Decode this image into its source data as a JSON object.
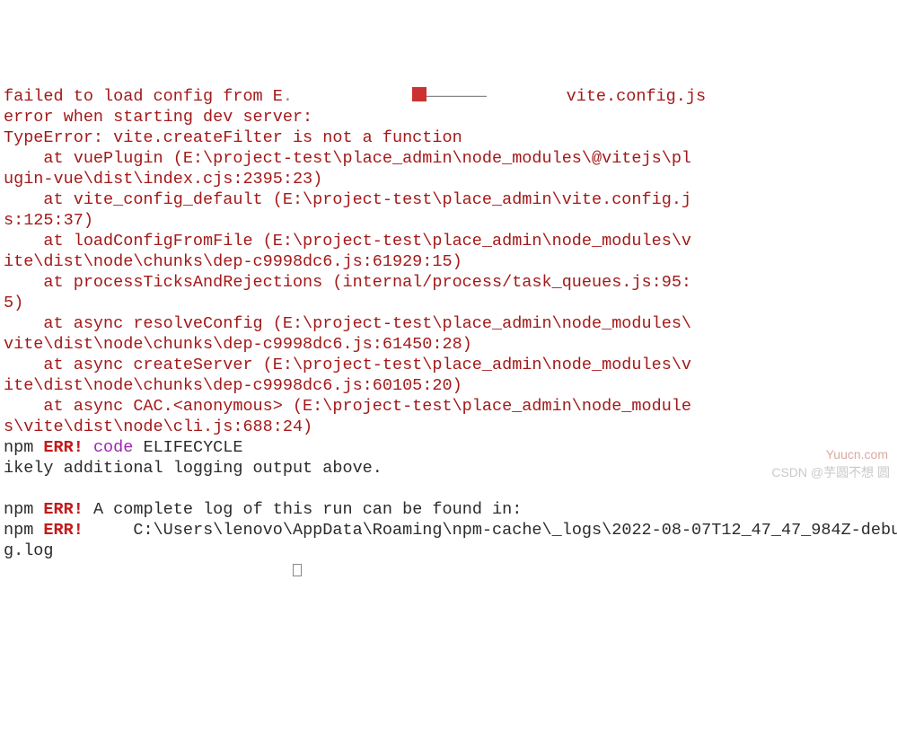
{
  "lines": [
    {
      "cls": "red",
      "pre": "failed to load config from E",
      "redblock": true,
      "mid": "",
      "after": "        vite.config.js"
    },
    {
      "cls": "red",
      "text": "error when starting dev server:"
    },
    {
      "cls": "red",
      "text": "TypeError: vite.createFilter is not a function"
    },
    {
      "cls": "red",
      "text": "    at vuePlugin (E:\\project-test\\place_admin\\node_modules\\@vitejs\\pl"
    },
    {
      "cls": "red",
      "text": "ugin-vue\\dist\\index.cjs:2395:23)"
    },
    {
      "cls": "red",
      "text": "    at vite_config_default (E:\\project-test\\place_admin\\vite.config.j"
    },
    {
      "cls": "red",
      "text": "s:125:37)"
    },
    {
      "cls": "red",
      "text": "    at loadConfigFromFile (E:\\project-test\\place_admin\\node_modules\\v"
    },
    {
      "cls": "red",
      "text": "ite\\dist\\node\\chunks\\dep-c9998dc6.js:61929:15)"
    },
    {
      "cls": "red",
      "text": "    at processTicksAndRejections (internal/process/task_queues.js:95:"
    },
    {
      "cls": "red",
      "text": "5)"
    },
    {
      "cls": "red",
      "text": "    at async resolveConfig (E:\\project-test\\place_admin\\node_modules\\"
    },
    {
      "cls": "red",
      "text": "vite\\dist\\node\\chunks\\dep-c9998dc6.js:61450:28)"
    },
    {
      "cls": "red",
      "text": "    at async createServer (E:\\project-test\\place_admin\\node_modules\\v"
    },
    {
      "cls": "red",
      "text": "ite\\dist\\node\\chunks\\dep-c9998dc6.js:60105:20)"
    },
    {
      "cls": "red",
      "text": "    at async CAC.<anonymous> (E:\\project-test\\place_admin\\node_module"
    },
    {
      "cls": "red",
      "text": "s\\vite\\dist\\node\\cli.js:688:24)"
    }
  ],
  "npm_err_code": {
    "npm": "npm",
    "err": "ERR!",
    "code": "code",
    "value": "ELIFECYCLE"
  },
  "extra_line": "ikely additional logging output above.",
  "blank": " ",
  "npm_err_log_header": {
    "npm": "npm",
    "err": "ERR!",
    "text": " A complete log of this run can be found in:"
  },
  "npm_err_log_path": {
    "npm": "npm",
    "err": "ERR!",
    "text": "     C:\\Users\\lenovo\\AppData\\Roaming\\npm-cache\\_logs\\2022-08-07T12_47_47_984Z-debu"
  },
  "npm_err_log_cont": "g.log",
  "watermark_brand": "Yuucn.com",
  "watermark_csdn": "CSDN @芋圆不想 圆"
}
